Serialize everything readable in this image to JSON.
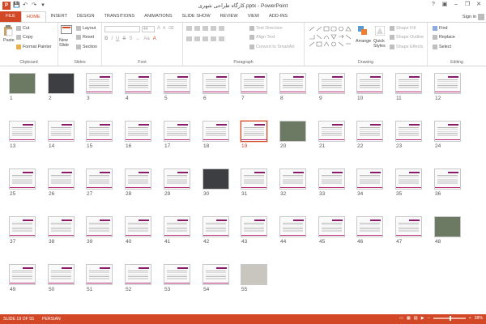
{
  "app": {
    "logo": "P",
    "window_title": "کارگاه طراحی شهری.pptx - PowerPoint"
  },
  "qat": {
    "save": "💾",
    "undo": "↶",
    "redo": "↷",
    "customize": "▾"
  },
  "window_controls": {
    "help": "?",
    "ribbon_options": "▣",
    "minimize": "–",
    "restore": "❐",
    "close": "✕"
  },
  "tabs": [
    "FILE",
    "HOME",
    "INSERT",
    "DESIGN",
    "TRANSITIONS",
    "ANIMATIONS",
    "SLIDE SHOW",
    "REVIEW",
    "VIEW",
    "ADD-INS"
  ],
  "signin": "Sign in",
  "ribbon": {
    "clipboard": {
      "paste": "Paste",
      "cut": "Cut",
      "copy": "Copy",
      "format_painter": "Format Painter",
      "label": "Clipboard"
    },
    "slides": {
      "new_slide": "New Slide",
      "layout": "Layout",
      "reset": "Reset",
      "section": "Section",
      "label": "Slides"
    },
    "font": {
      "size": "44",
      "label": "Font"
    },
    "paragraph": {
      "text_direction": "Text Direction",
      "align_text": "Align Text",
      "convert_smartart": "Convert to SmartArt",
      "label": "Paragraph"
    },
    "drawing": {
      "arrange": "Arrange",
      "quick_styles": "Quick Styles",
      "shape_fill": "Shape Fill",
      "shape_outline": "Shape Outline",
      "shape_effects": "Shape Effects",
      "label": "Drawing"
    },
    "editing": {
      "find": "Find",
      "replace": "Replace",
      "select": "Select",
      "label": "Editing"
    }
  },
  "slides": {
    "count": 55,
    "selected": 19,
    "photo_slides": [
      1,
      2,
      20,
      30,
      48,
      55
    ],
    "dark_photo_slides": [
      2,
      30
    ],
    "light_photo_slides": [
      55
    ]
  },
  "status": {
    "slide_info": "SLIDE 19 OF 55",
    "language": "PERSIAN",
    "zoom": "38%"
  },
  "colors": {
    "accent": "#d24726",
    "slide_title": "#8b1a6b",
    "slide_footer": "#b8337e"
  }
}
